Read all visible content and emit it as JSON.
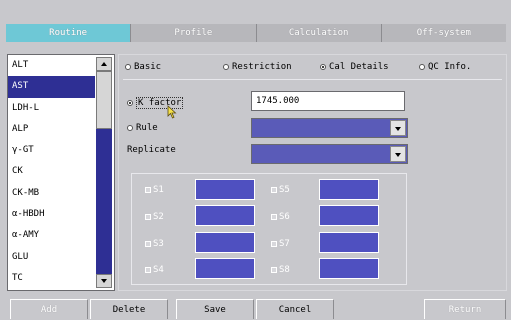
{
  "tabs": [
    {
      "label": "Routine",
      "active": true
    },
    {
      "label": "Profile",
      "active": false
    },
    {
      "label": "Calculation",
      "active": false
    },
    {
      "label": "Off-system",
      "active": false
    }
  ],
  "test_list": {
    "items": [
      "ALT",
      "AST",
      "LDH-L",
      "ALP",
      "γ-GT",
      "CK",
      "CK-MB",
      "α-HBDH",
      "α-AMY",
      "GLU",
      "TC"
    ],
    "selected": "AST"
  },
  "view_options": [
    {
      "label": "Basic",
      "selected": false
    },
    {
      "label": "Restriction",
      "selected": false
    },
    {
      "label": "Cal Details",
      "selected": true
    },
    {
      "label": "QC Info.",
      "selected": false
    }
  ],
  "cal_details": {
    "k_factor_label": "K factor",
    "k_factor_value": "1745.000",
    "rule_label": "Rule",
    "replicate_label": "Replicate",
    "k_factor_selected": true,
    "rule_selected": false
  },
  "replicates": {
    "left": [
      "S1",
      "S2",
      "S3",
      "S4"
    ],
    "right": [
      "S5",
      "S6",
      "S7",
      "S8"
    ]
  },
  "buttons": {
    "add": "Add",
    "delete": "Delete",
    "save": "Save",
    "cancel": "Cancel",
    "return": "Return"
  },
  "colors": {
    "tab_active": "#6ec8d6",
    "selection": "#2e2f94",
    "field_blue": "#4f50c0",
    "background": "#c8c8cc"
  }
}
